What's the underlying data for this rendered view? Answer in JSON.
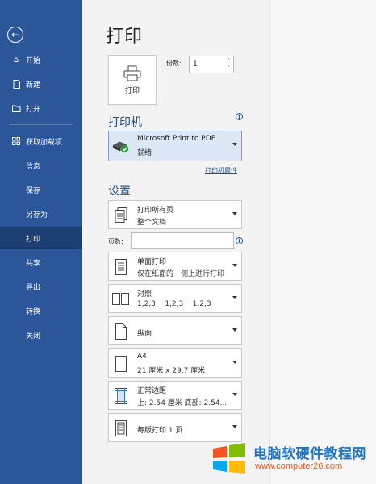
{
  "sidebar": {
    "back_label": "←",
    "items": [
      {
        "label": "开始",
        "icon": "home-icon"
      },
      {
        "label": "新建",
        "icon": "new-document-icon"
      },
      {
        "label": "打开",
        "icon": "open-folder-icon"
      },
      {
        "label": "获取加载项",
        "icon": "add-ins-icon"
      },
      {
        "label": "信息"
      },
      {
        "label": "保存"
      },
      {
        "label": "另存为"
      },
      {
        "label": "打印",
        "active": true
      },
      {
        "label": "共享"
      },
      {
        "label": "导出"
      },
      {
        "label": "转换"
      },
      {
        "label": "关闭"
      }
    ]
  },
  "main": {
    "title": "打印",
    "print_button_label": "打印",
    "copies_label": "份数:",
    "copies_value": "1",
    "printer_section": "打印机",
    "printer": {
      "name": "Microsoft Print to PDF",
      "status": "就绪"
    },
    "printer_properties_link": "打印机属性",
    "settings_section": "设置",
    "settings": [
      {
        "line1": "打印所有页",
        "line2": "整个文档"
      },
      {
        "line1": "单面打印",
        "line2": "仅在纸面的一侧上进行打印"
      },
      {
        "line1": "对照",
        "line2": "1,2,3    1,2,3    1,2,3"
      },
      {
        "line1": "纵向"
      },
      {
        "line1": "A4",
        "line2": "21 厘米 x 29.7 厘米"
      },
      {
        "line1": "正常边距",
        "line2": "上: 2.54 厘米 底部: 2.54..."
      },
      {
        "line1": "每版打印 1 页"
      }
    ],
    "pages_label": "页数:",
    "pages_value": ""
  },
  "watermark": {
    "line1": "电脑软硬件教程网",
    "line2": "www.computer26.com"
  },
  "colors": {
    "sidebar": "#2b579a",
    "sidebar_active": "#1b3f73",
    "accent": "#1f4e8c"
  }
}
